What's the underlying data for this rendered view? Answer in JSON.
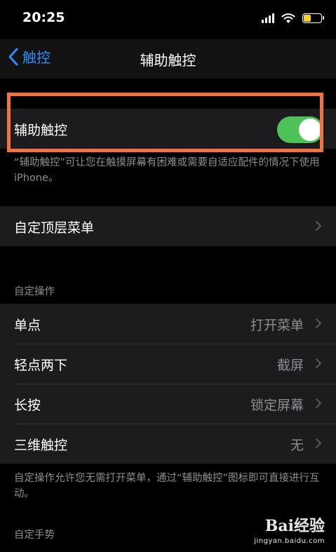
{
  "status_bar": {
    "time": "20:25"
  },
  "nav": {
    "back_label": "触控",
    "title": "辅助触控"
  },
  "main_toggle": {
    "label": "辅助触控",
    "on": true
  },
  "toggle_footnote": "“辅助触控”可让您在触摸屏幕有困难或需要自适应配件的情况下使用iPhone。",
  "top_menu": {
    "label": "自定顶层菜单"
  },
  "custom_actions": {
    "header": "自定操作",
    "rows": [
      {
        "label": "单点",
        "value": "打开菜单"
      },
      {
        "label": "轻点两下",
        "value": "截屏"
      },
      {
        "label": "长按",
        "value": "锁定屏幕"
      },
      {
        "label": "三维触控",
        "value": "无"
      }
    ],
    "footnote": "自定操作允许您无需打开菜单，通过“辅助触控”图标即可直接进行互动。"
  },
  "custom_gestures": {
    "header": "自定手势"
  },
  "watermark": {
    "logo": "Bai经验",
    "url": "jingyan.baidu.com"
  },
  "colors": {
    "accent": "#2f8cf6",
    "toggle_on": "#4ec257",
    "highlight": "#f07442",
    "cell_bg": "#1c1c1e"
  }
}
